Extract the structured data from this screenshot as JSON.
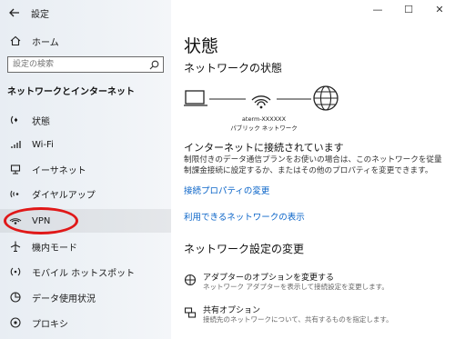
{
  "app": {
    "title": "設定"
  },
  "sidebar": {
    "home_label": "ホーム",
    "search_placeholder": "設定の検索",
    "section_title": "ネットワークとインターネット",
    "items": [
      {
        "label": "状態",
        "icon": "status-icon"
      },
      {
        "label": "Wi-Fi",
        "icon": "wifi-icon"
      },
      {
        "label": "イーサネット",
        "icon": "ethernet-icon"
      },
      {
        "label": "ダイヤルアップ",
        "icon": "dialup-icon"
      },
      {
        "label": "VPN",
        "icon": "vpn-icon",
        "selected": true,
        "highlighted": true
      },
      {
        "label": "機内モード",
        "icon": "airplane-icon"
      },
      {
        "label": "モバイル ホットスポット",
        "icon": "hotspot-icon"
      },
      {
        "label": "データ使用状況",
        "icon": "data-usage-icon"
      },
      {
        "label": "プロキシ",
        "icon": "proxy-icon"
      }
    ]
  },
  "main": {
    "title": "状態",
    "network_status_heading": "ネットワークの状態",
    "diagram": {
      "ssid": "aterm-XXXXXX",
      "network_type": "パブリック ネットワーク"
    },
    "connection_status": "インターネットに接続されています",
    "description": "制限付きのデータ通信プランをお使いの場合は、このネットワークを従量制課金接続に設定するか、またはその他のプロパティを変更できます。",
    "link_properties": "接続プロパティの変更",
    "link_available_networks": "利用できるネットワークの表示",
    "settings_heading": "ネットワーク設定の変更",
    "settings": [
      {
        "title": "アダプターのオプションを変更する",
        "subtitle": "ネットワーク アダプターを表示して接続設定を変更します。",
        "icon": "adapter-icon"
      },
      {
        "title": "共有オプション",
        "subtitle": "接続先のネットワークについて、共有するものを指定します。",
        "icon": "sharing-icon"
      }
    ]
  },
  "window_controls": {
    "minimize": "—",
    "maximize": "☐",
    "close": "✕"
  },
  "colors": {
    "link": "#0a64c8",
    "highlight_ring": "#e01818",
    "sidebar_bg": "#eef2f6"
  }
}
